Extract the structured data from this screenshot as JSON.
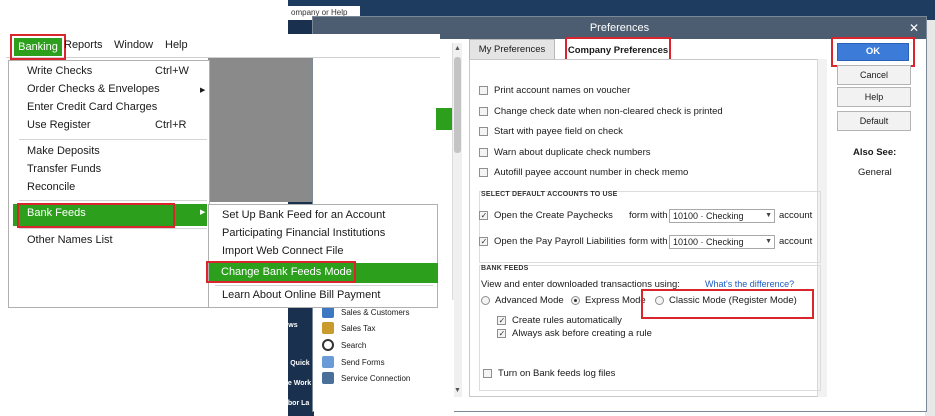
{
  "background_app": {
    "search_placeholder": "ompany or Help",
    "left_nav_items": [
      "ows",
      "h Quick",
      "ee Work",
      "abor La"
    ],
    "shortcuts": [
      {
        "label": "Sales & Customers",
        "icon": "sales-customers-icon"
      },
      {
        "label": "Sales Tax",
        "icon": "sales-tax-icon"
      },
      {
        "label": "Search",
        "icon": "search-icon"
      },
      {
        "label": "Send Forms",
        "icon": "send-forms-icon"
      },
      {
        "label": "Service Connection",
        "icon": "service-connection-icon"
      }
    ]
  },
  "menubar": {
    "items": [
      "Banking",
      "Reports",
      "Window",
      "Help"
    ]
  },
  "banking_menu": {
    "items": [
      {
        "label": "Write Checks",
        "shortcut": "Ctrl+W"
      },
      {
        "label": "Order Checks & Envelopes",
        "shortcut": ""
      },
      {
        "label": "Enter Credit Card Charges",
        "shortcut": ""
      },
      {
        "label": "Use Register",
        "shortcut": "Ctrl+R"
      },
      {
        "label": "Make Deposits",
        "shortcut": ""
      },
      {
        "label": "Transfer Funds",
        "shortcut": ""
      },
      {
        "label": "Reconcile",
        "shortcut": ""
      },
      {
        "label": "Bank Feeds",
        "shortcut": ""
      },
      {
        "label": "Other Names List",
        "shortcut": ""
      }
    ]
  },
  "bank_feeds_submenu": {
    "items": [
      "Set Up Bank Feed for an Account",
      "Participating Financial Institutions",
      "Import Web Connect File",
      "Change Bank Feeds Mode",
      "Learn About Online Bill Payment"
    ]
  },
  "preferences": {
    "title": "Preferences",
    "tabs": {
      "my": "My Preferences",
      "company": "Company Preferences"
    },
    "checkboxes": [
      {
        "label": "Print account names on voucher",
        "checked": false
      },
      {
        "label": "Change check date when non-cleared check is printed",
        "checked": false
      },
      {
        "label": "Start with payee field on check",
        "checked": false
      },
      {
        "label": "Warn about duplicate check numbers",
        "checked": false
      },
      {
        "label": "Autofill payee account number in check memo",
        "checked": false
      }
    ],
    "default_accounts": {
      "title": "SELECT DEFAULT ACCOUNTS TO USE",
      "rows": [
        {
          "label": "Open the Create Paychecks",
          "form_with": "form with",
          "account_value": "10100 · Checking",
          "account_suffix": "account",
          "checked": true
        },
        {
          "label": "Open the Pay Payroll Liabilities",
          "form_with": "form with",
          "account_value": "10100 · Checking",
          "account_suffix": "account",
          "checked": true
        }
      ]
    },
    "bank_feeds": {
      "title": "BANK FEEDS",
      "view_label": "View and enter downloaded transactions using:",
      "whats_diff": "What's the difference?",
      "modes": [
        {
          "label": "Advanced Mode",
          "selected": false
        },
        {
          "label": "Express Mode",
          "selected": true
        },
        {
          "label": "Classic Mode (Register Mode)",
          "selected": false
        }
      ],
      "options": [
        {
          "label": "Create rules automatically",
          "checked": true
        },
        {
          "label": "Always ask before creating a rule",
          "checked": true
        }
      ],
      "log_label": "Turn on Bank feeds log files"
    },
    "buttons": {
      "ok": "OK",
      "cancel": "Cancel",
      "help": "Help",
      "default": "Default"
    },
    "also_see": {
      "label": "Also See:",
      "general": "General"
    }
  },
  "colors": {
    "accent_green": "#2ca01c",
    "highlight_red": "#d9262c",
    "ok_blue": "#3d7bd9",
    "titlebar": "#4c5d71"
  }
}
